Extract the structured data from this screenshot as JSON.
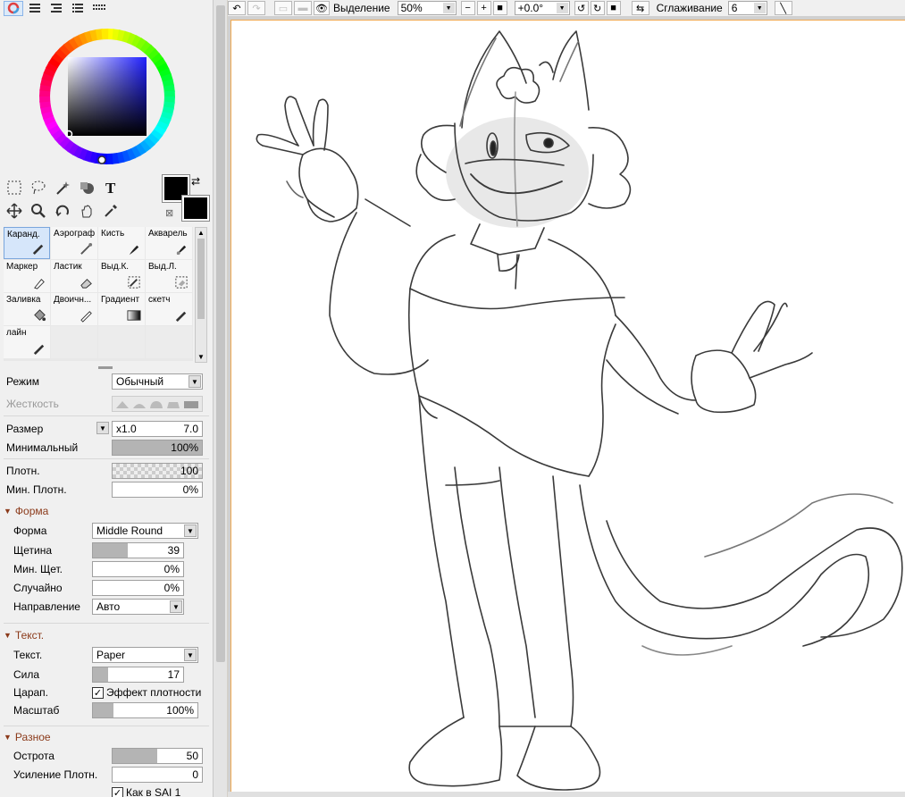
{
  "left_panel": {
    "brushes": [
      {
        "label": "Каранд.",
        "icon": "pencil-icon"
      },
      {
        "label": "Аэрограф",
        "icon": "airbrush-icon"
      },
      {
        "label": "Кисть",
        "icon": "brush-icon"
      },
      {
        "label": "Акварель",
        "icon": "watercolor-icon"
      },
      {
        "label": "Маркер",
        "icon": "marker-icon"
      },
      {
        "label": "Ластик",
        "icon": "eraser-icon"
      },
      {
        "label": "Выд.К.",
        "icon": "select-pen-icon"
      },
      {
        "label": "Выд.Л.",
        "icon": "select-eraser-icon"
      },
      {
        "label": "Заливка",
        "icon": "bucket-icon"
      },
      {
        "label": "Двоичн...",
        "icon": "binary-pen-icon"
      },
      {
        "label": "Градиент",
        "icon": "gradient-icon"
      },
      {
        "label": "скетч",
        "icon": "sketch-pen-icon"
      },
      {
        "label": "лайн",
        "icon": "line-pen-icon"
      }
    ],
    "mode": {
      "label": "Режим",
      "value": "Обычный"
    },
    "hardness": {
      "label": "Жесткость"
    },
    "size": {
      "label": "Размер",
      "multiplier": "x1.0",
      "value": "7.0"
    },
    "min_size": {
      "label": "Минимальный",
      "value": "100%"
    },
    "density": {
      "label": "Плотн.",
      "value": "100"
    },
    "min_density": {
      "label": "Мин. Плотн.",
      "value": "0%"
    },
    "shape_section": {
      "title": "Форма",
      "shape": {
        "label": "Форма",
        "value": "Middle Round"
      },
      "bristle": {
        "label": "Щетина",
        "value": "39",
        "fill": 0.39
      },
      "min_bristle": {
        "label": "Мин. Щет.",
        "value": "0%"
      },
      "random": {
        "label": "Случайно",
        "value": "0%"
      },
      "direction": {
        "label": "Направление",
        "value": "Авто"
      }
    },
    "texture_section": {
      "title": "Текст.",
      "texture": {
        "label": "Текст.",
        "value": "Paper"
      },
      "strength": {
        "label": "Сила",
        "value": "17",
        "fill": 0.17
      },
      "scratch": {
        "label": "Царап.",
        "checkbox_label": "Эффект плотности",
        "checked": true
      },
      "scale": {
        "label": "Масштаб",
        "value": "100%",
        "fill": 0.2
      }
    },
    "misc_section": {
      "title": "Разное",
      "sharpness": {
        "label": "Острота",
        "value": "50",
        "fill": 0.5
      },
      "density_boost": {
        "label": "Усиление Плотн.",
        "value": "0"
      },
      "sai1": {
        "label": "Как в SAI 1",
        "checked": true
      }
    }
  },
  "toolbar": {
    "selection_label": "Выделение",
    "zoom": "50%",
    "rotation": "+0.0°",
    "smoothing_label": "Сглаживание",
    "smoothing_value": "6"
  },
  "colors": {
    "accent_border": "#f0a850",
    "section_title": "#8b3a1a",
    "active_brush": "#d6e6fa"
  }
}
